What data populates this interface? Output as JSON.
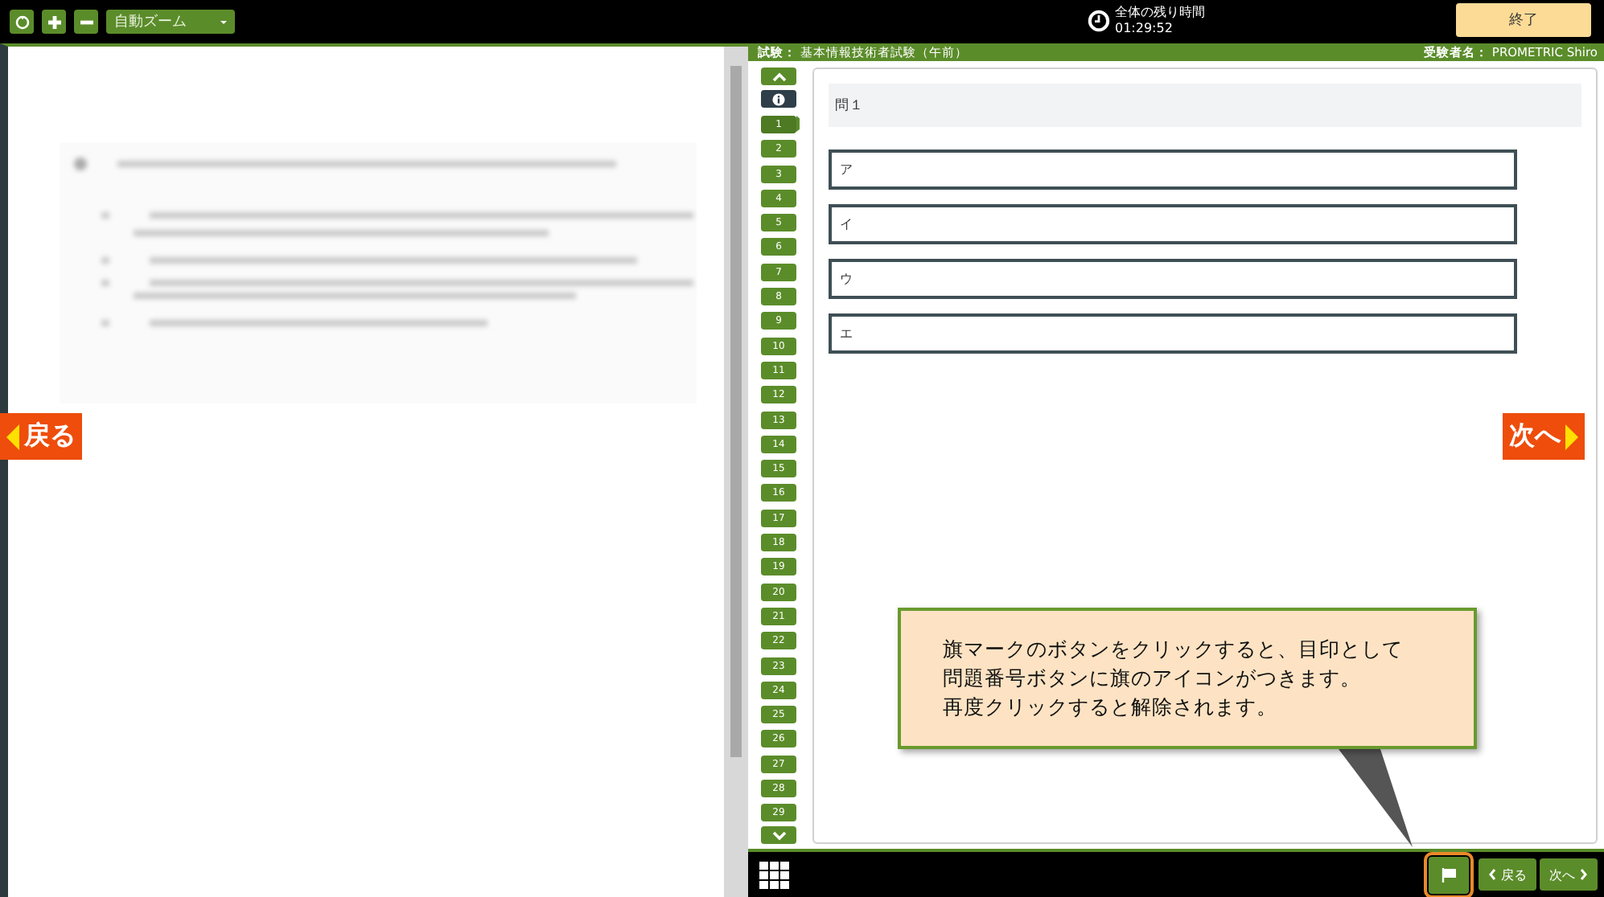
{
  "toolbar": {
    "zoom_select": "自動ズーム"
  },
  "timer": {
    "label": "全体の残り時間",
    "value": "01:29:52"
  },
  "end_button": "終了",
  "header": {
    "exam_label": "試験：",
    "exam_name": "基本情報技術者試験（午前）",
    "candidate_label": "受験者名：",
    "candidate_name": "PROMETRIC Shiro"
  },
  "question_nav": [
    {
      "label": "1",
      "selected": true
    },
    {
      "label": "2",
      "selected": false
    },
    {
      "label": "3",
      "selected": false
    },
    {
      "label": "4",
      "selected": false
    },
    {
      "label": "5",
      "selected": false
    },
    {
      "label": "6",
      "selected": false
    },
    {
      "label": "7",
      "selected": false
    },
    {
      "label": "8",
      "selected": false
    },
    {
      "label": "9",
      "selected": false
    },
    {
      "label": "10",
      "selected": false
    },
    {
      "label": "11",
      "selected": false
    },
    {
      "label": "12",
      "selected": false
    },
    {
      "label": "13",
      "selected": false
    },
    {
      "label": "14",
      "selected": false
    },
    {
      "label": "15",
      "selected": false
    },
    {
      "label": "16",
      "selected": false
    },
    {
      "label": "17",
      "selected": false
    },
    {
      "label": "18",
      "selected": false
    },
    {
      "label": "19",
      "selected": false
    },
    {
      "label": "20",
      "selected": false
    },
    {
      "label": "21",
      "selected": false
    },
    {
      "label": "22",
      "selected": false
    },
    {
      "label": "23",
      "selected": false
    },
    {
      "label": "24",
      "selected": false
    },
    {
      "label": "25",
      "selected": false
    },
    {
      "label": "26",
      "selected": false
    },
    {
      "label": "27",
      "selected": false
    },
    {
      "label": "28",
      "selected": false
    },
    {
      "label": "29",
      "selected": false
    }
  ],
  "question": {
    "title": "問１",
    "options": [
      {
        "label": "ア",
        "selected": false
      },
      {
        "label": "イ",
        "selected": false
      },
      {
        "label": "ウ",
        "selected": false
      },
      {
        "label": "エ",
        "selected": false
      }
    ]
  },
  "side_nav": {
    "prev": "戻る",
    "next": "次へ"
  },
  "bottom_bar": {
    "flag_highlighted": true,
    "prev": "戻る",
    "next": "次へ"
  },
  "callout": {
    "lines": [
      "旗マークのボタンをクリックすると、目印として",
      "問題番号ボタンに旗のアイコンがつきます。",
      "再度クリックすると解除されます。"
    ]
  }
}
